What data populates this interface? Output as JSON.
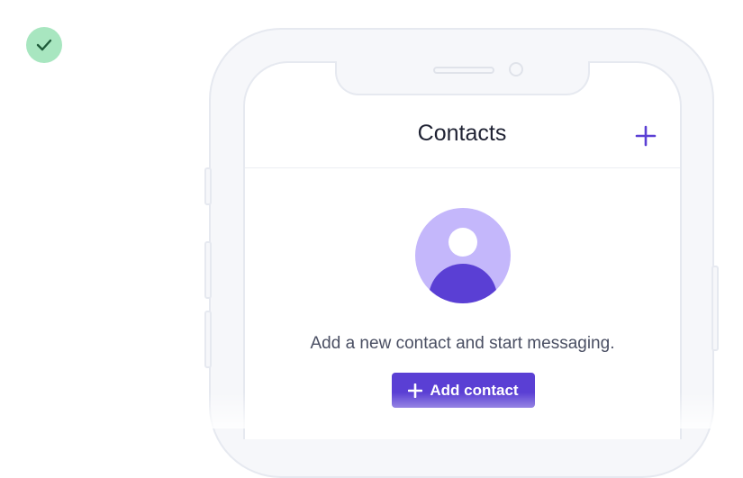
{
  "status": {
    "icon": "check-icon",
    "color": "#a8e6c0",
    "icon_color": "#1f5b3a"
  },
  "header": {
    "title": "Contacts",
    "add_icon": "plus-icon"
  },
  "empty_state": {
    "avatar_icon": "user-avatar-icon",
    "message": "Add a new contact and start messaging.",
    "button_label": "Add contact",
    "button_icon": "plus-icon"
  },
  "colors": {
    "accent": "#5a3fd4",
    "avatar_bg": "#c4b7fb",
    "frame": "#e6e9f0",
    "text": "#1f2233"
  }
}
